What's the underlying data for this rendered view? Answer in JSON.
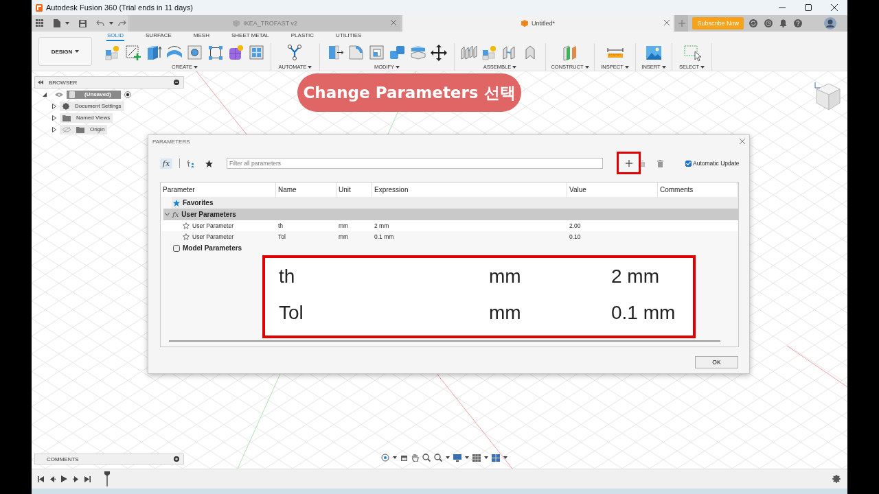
{
  "window": {
    "title": "Autodesk Fusion 360 (Trial ends in 11 days)"
  },
  "document_tabs": [
    {
      "label": "IKEA_TROFAST v2",
      "selected": false
    },
    {
      "label": "Untitled*",
      "selected": true
    }
  ],
  "subscribe_button": "Subscribe Now",
  "workspace_button": "DESIGN",
  "toolbar_tabs": [
    {
      "label": "SOLID",
      "selected": true
    },
    {
      "label": "SURFACE",
      "selected": false
    },
    {
      "label": "MESH",
      "selected": false
    },
    {
      "label": "SHEET METAL",
      "selected": false
    },
    {
      "label": "PLASTIC",
      "selected": false
    },
    {
      "label": "UTILITIES",
      "selected": false
    }
  ],
  "toolbar_groups": [
    "CREATE",
    "AUTOMATE",
    "MODIFY",
    "ASSEMBLE",
    "CONSTRUCT",
    "INSPECT",
    "INSERT",
    "SELECT"
  ],
  "browser": {
    "title": "BROWSER",
    "root": {
      "label": "(Unsaved)",
      "expanded": true,
      "children": [
        {
          "label": "Document Settings",
          "kind": "settings",
          "expanded": false
        },
        {
          "label": "Named Views",
          "kind": "folder",
          "expanded": false
        },
        {
          "label": "Origin",
          "kind": "folder",
          "expanded": false
        }
      ]
    }
  },
  "comments_panel": {
    "title": "COMMENTS"
  },
  "callout": "Change Parameters 선택",
  "dialog": {
    "title": "PARAMETERS",
    "function_button": "fx",
    "filter_placeholder": "Filter all parameters",
    "automatic_update": {
      "label": "Automatic Update",
      "checked": true
    },
    "columns": [
      "Parameter",
      "Name",
      "Unit",
      "Expression",
      "Value",
      "Comments"
    ],
    "groups": [
      {
        "label": "Favorites",
        "kind": "favorites",
        "expanded": false
      },
      {
        "label": "User Parameters",
        "kind": "user",
        "icon_text": "fx",
        "expanded": true,
        "rows": [
          {
            "parameter": "User Parameter",
            "name": "th",
            "unit": "mm",
            "expression": "2 mm",
            "value": "2.00",
            "favorite": false
          },
          {
            "parameter": "User Parameter",
            "name": "Tol",
            "unit": "mm",
            "expression": "0.1 mm",
            "value": "0.10",
            "favorite": false
          }
        ]
      },
      {
        "label": "Model Parameters",
        "kind": "model",
        "expanded": false
      }
    ],
    "ok_button": "OK"
  },
  "zoom_callout": {
    "rows": [
      {
        "name": "th",
        "unit": "mm",
        "expression": "2 mm"
      },
      {
        "name": "Tol",
        "unit": "mm",
        "expression": "0.1 mm"
      }
    ]
  }
}
